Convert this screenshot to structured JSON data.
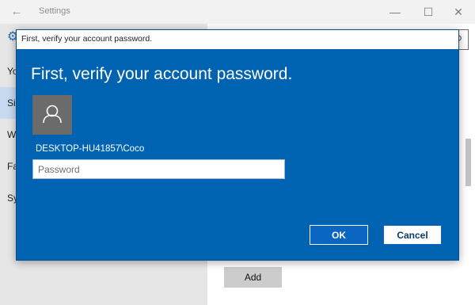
{
  "window": {
    "title": "Settings",
    "back_icon": "back-arrow-icon",
    "controls": {
      "minimize": "—",
      "maximize": "☐",
      "close": "✕"
    }
  },
  "sidebar": {
    "items": [
      {
        "label": "Yo"
      },
      {
        "label": "Si"
      },
      {
        "label": "W"
      },
      {
        "label": "Fa"
      },
      {
        "label": "Sy"
      }
    ]
  },
  "main": {
    "add_label": "Add"
  },
  "dialog": {
    "titlebar_text": "First, verify your account password.",
    "heading": "First, verify your account password.",
    "account": "DESKTOP-HU41857\\Coco",
    "password_placeholder": "Password",
    "password_value": "",
    "ok_label": "OK",
    "cancel_label": "Cancel"
  },
  "colors": {
    "dialog_background": "#0063b1",
    "avatar": "#6b6b6b",
    "sidebar": "#e6e6e6",
    "selected_nav": "#c7daf0"
  }
}
